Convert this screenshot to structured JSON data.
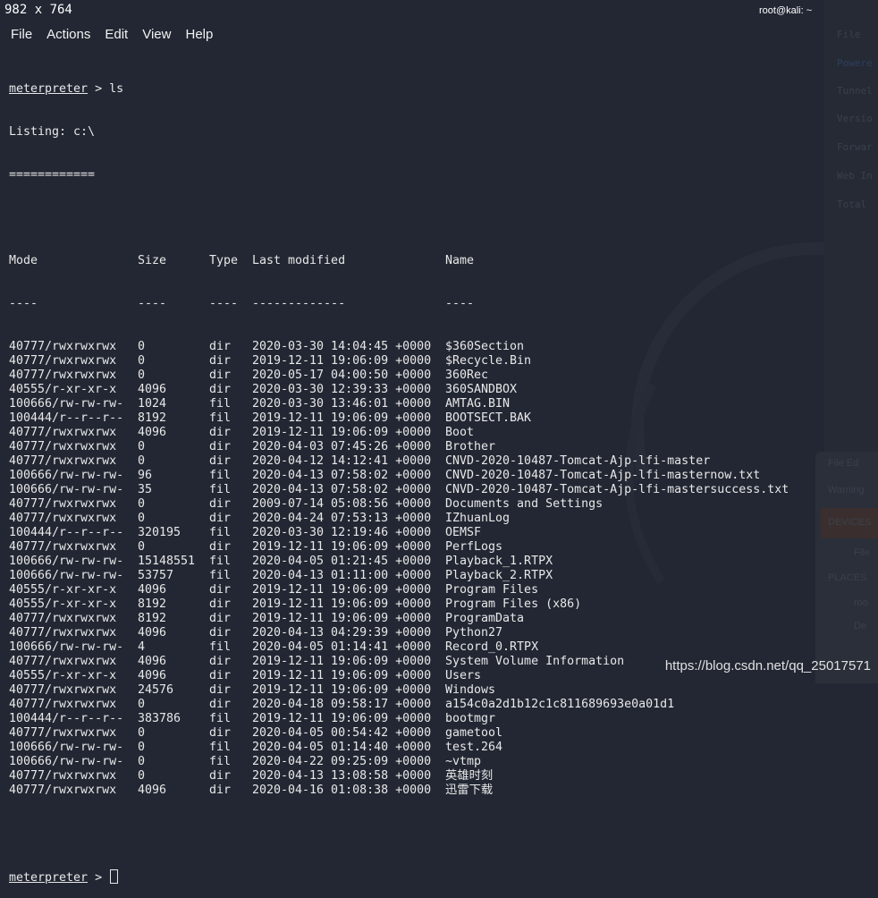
{
  "overlay_dims": "982 x 764",
  "window_title": "root@kali: ~",
  "menu": [
    "File",
    "Actions",
    "Edit",
    "View",
    "Help"
  ],
  "prompt": "meterpreter",
  "prompt_sep": " > ",
  "command": "ls",
  "listing": "Listing: c:\\",
  "listing_rule": "============",
  "columns": [
    "Mode",
    "Size",
    "Type",
    "Last modified",
    "Name"
  ],
  "column_rules": [
    "----",
    "----",
    "----",
    "-------------",
    "----"
  ],
  "rows": [
    [
      "40777/rwxrwxrwx",
      "0",
      "dir",
      "2020-03-30 14:04:45 +0000",
      "$360Section"
    ],
    [
      "40777/rwxrwxrwx",
      "0",
      "dir",
      "2019-12-11 19:06:09 +0000",
      "$Recycle.Bin"
    ],
    [
      "40777/rwxrwxrwx",
      "0",
      "dir",
      "2020-05-17 04:00:50 +0000",
      "360Rec"
    ],
    [
      "40555/r-xr-xr-x",
      "4096",
      "dir",
      "2020-03-30 12:39:33 +0000",
      "360SANDBOX"
    ],
    [
      "100666/rw-rw-rw-",
      "1024",
      "fil",
      "2020-03-30 13:46:01 +0000",
      "AMTAG.BIN"
    ],
    [
      "100444/r--r--r--",
      "8192",
      "fil",
      "2019-12-11 19:06:09 +0000",
      "BOOTSECT.BAK"
    ],
    [
      "40777/rwxrwxrwx",
      "4096",
      "dir",
      "2019-12-11 19:06:09 +0000",
      "Boot"
    ],
    [
      "40777/rwxrwxrwx",
      "0",
      "dir",
      "2020-04-03 07:45:26 +0000",
      "Brother"
    ],
    [
      "40777/rwxrwxrwx",
      "0",
      "dir",
      "2020-04-12 14:12:41 +0000",
      "CNVD-2020-10487-Tomcat-Ajp-lfi-master"
    ],
    [
      "100666/rw-rw-rw-",
      "96",
      "fil",
      "2020-04-13 07:58:02 +0000",
      "CNVD-2020-10487-Tomcat-Ajp-lfi-masternow.txt"
    ],
    [
      "100666/rw-rw-rw-",
      "35",
      "fil",
      "2020-04-13 07:58:02 +0000",
      "CNVD-2020-10487-Tomcat-Ajp-lfi-mastersuccess.txt"
    ],
    [
      "40777/rwxrwxrwx",
      "0",
      "dir",
      "2009-07-14 05:08:56 +0000",
      "Documents and Settings"
    ],
    [
      "40777/rwxrwxrwx",
      "0",
      "dir",
      "2020-04-24 07:53:13 +0000",
      "IZhuanLog"
    ],
    [
      "100444/r--r--r--",
      "320195",
      "fil",
      "2020-03-30 12:19:46 +0000",
      "OEMSF"
    ],
    [
      "40777/rwxrwxrwx",
      "0",
      "dir",
      "2019-12-11 19:06:09 +0000",
      "PerfLogs"
    ],
    [
      "100666/rw-rw-rw-",
      "15148551",
      "fil",
      "2020-04-05 01:21:45 +0000",
      "Playback_1.RTPX"
    ],
    [
      "100666/rw-rw-rw-",
      "53757",
      "fil",
      "2020-04-13 01:11:00 +0000",
      "Playback_2.RTPX"
    ],
    [
      "40555/r-xr-xr-x",
      "4096",
      "dir",
      "2019-12-11 19:06:09 +0000",
      "Program Files"
    ],
    [
      "40555/r-xr-xr-x",
      "8192",
      "dir",
      "2019-12-11 19:06:09 +0000",
      "Program Files (x86)"
    ],
    [
      "40777/rwxrwxrwx",
      "8192",
      "dir",
      "2019-12-11 19:06:09 +0000",
      "ProgramData"
    ],
    [
      "40777/rwxrwxrwx",
      "4096",
      "dir",
      "2020-04-13 04:29:39 +0000",
      "Python27"
    ],
    [
      "100666/rw-rw-rw-",
      "4",
      "fil",
      "2020-04-05 01:14:41 +0000",
      "Record_0.RTPX"
    ],
    [
      "40777/rwxrwxrwx",
      "4096",
      "dir",
      "2019-12-11 19:06:09 +0000",
      "System Volume Information"
    ],
    [
      "40555/r-xr-xr-x",
      "4096",
      "dir",
      "2019-12-11 19:06:09 +0000",
      "Users"
    ],
    [
      "40777/rwxrwxrwx",
      "24576",
      "dir",
      "2019-12-11 19:06:09 +0000",
      "Windows"
    ],
    [
      "40777/rwxrwxrwx",
      "0",
      "dir",
      "2020-04-18 09:58:17 +0000",
      "a154c0a2d1b12c1c811689693e0a01d1"
    ],
    [
      "100444/r--r--r--",
      "383786",
      "fil",
      "2019-12-11 19:06:09 +0000",
      "bootmgr"
    ],
    [
      "40777/rwxrwxrwx",
      "0",
      "dir",
      "2020-04-05 00:54:42 +0000",
      "gametool"
    ],
    [
      "100666/rw-rw-rw-",
      "0",
      "fil",
      "2020-04-05 01:14:40 +0000",
      "test.264"
    ],
    [
      "100666/rw-rw-rw-",
      "0",
      "fil",
      "2020-04-22 09:25:09 +0000",
      "~vtmp"
    ],
    [
      "40777/rwxrwxrwx",
      "0",
      "dir",
      "2020-04-13 13:08:58 +0000",
      "英雄时刻"
    ],
    [
      "40777/rwxrwxrwx",
      "4096",
      "dir",
      "2020-04-16 01:08:38 +0000",
      "迅雷下载"
    ]
  ],
  "background_window": {
    "lines": [
      "File",
      "Powere",
      "Tunnel",
      "Versio",
      "Forwar",
      "Web In",
      "Total"
    ],
    "lower": [
      "File  Ed",
      "Warning",
      "DEVICES",
      "File",
      "PLACES",
      "roo",
      "De"
    ]
  },
  "watermark": "https://blog.csdn.net/qq_25017571"
}
